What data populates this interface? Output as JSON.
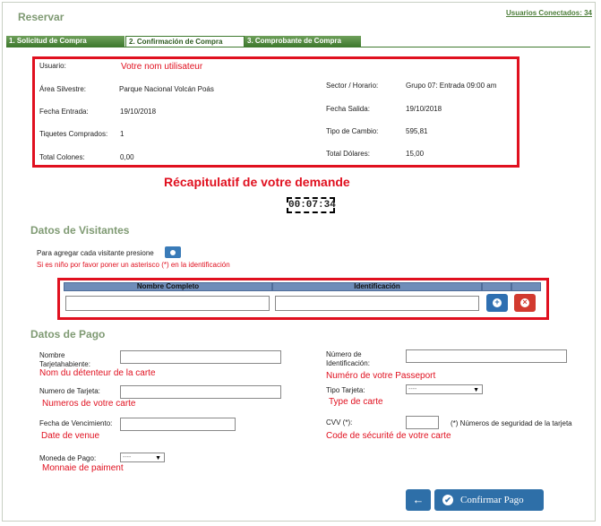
{
  "header": {
    "title": "Reservar",
    "users_connected": "Usuarios Conectados: 34"
  },
  "tabs": [
    {
      "label": "1. Solicitud de Compra"
    },
    {
      "label": "2. Confirmación de Compra"
    },
    {
      "label": "3. Comprobante de Compra"
    }
  ],
  "summary": {
    "usuario_label": "Usuario:",
    "usuario_note": "Votre nom utilisateur",
    "area_label": "Área Silvestre:",
    "area_value": "Parque Nacional Volcán Poás",
    "sector_label": "Sector / Horario:",
    "sector_value": "Grupo 07: Entrada 09:00 am",
    "fecha_entrada_label": "Fecha Entrada:",
    "fecha_entrada_value": "19/10/2018",
    "fecha_salida_label": "Fecha Salida:",
    "fecha_salida_value": "19/10/2018",
    "tiquetes_label": "Tiquetes Comprados:",
    "tiquetes_value": "1",
    "tipo_cambio_label": "Tipo de Cambio:",
    "tipo_cambio_value": "595,81",
    "total_colones_label": "Total Colones:",
    "total_colones_value": "0,00",
    "total_dolares_label": "Total Dólares:",
    "total_dolares_value": "15,00"
  },
  "recap_note": "Récapitulatif de votre demande",
  "timer": "00:07:34",
  "visitantes": {
    "heading": "Datos de Visitantes",
    "add_prompt": "Para agregar cada visitante presione",
    "child_hint": "Si es niño por favor poner un asterisco (*) en la identificación",
    "col_name": "Nombre Completo",
    "col_id": "Identificación"
  },
  "pago": {
    "heading": "Datos de Pago",
    "nombre_label": "Nombre Tarjetahabiente:",
    "nombre_note": "Nom du détenteur de la carte",
    "numero_id_label": "Número de Identificación:",
    "numero_id_note": "Numéro de votre Passeport",
    "numero_tarjeta_label": "Numero de Tarjeta:",
    "numero_tarjeta_note": "Numeros de votre carte",
    "tipo_tarjeta_label": "Tipo Tarjeta:",
    "tipo_tarjeta_value": "----",
    "tipo_tarjeta_note": "Type de carte",
    "vencimiento_label": "Fecha de Vencimiento:",
    "vencimiento_note": "Date de venue",
    "cvv_label": "CVV (*):",
    "cvv_hint": "(*) Números de seguridad de la tarjeta",
    "cvv_note": "Code de sécurité de votre carte",
    "moneda_label": "Moneda de Pago:",
    "moneda_value": "----",
    "moneda_note": "Monnaie de paiment"
  },
  "actions": {
    "confirm_label": "Confirmar   Pago"
  }
}
